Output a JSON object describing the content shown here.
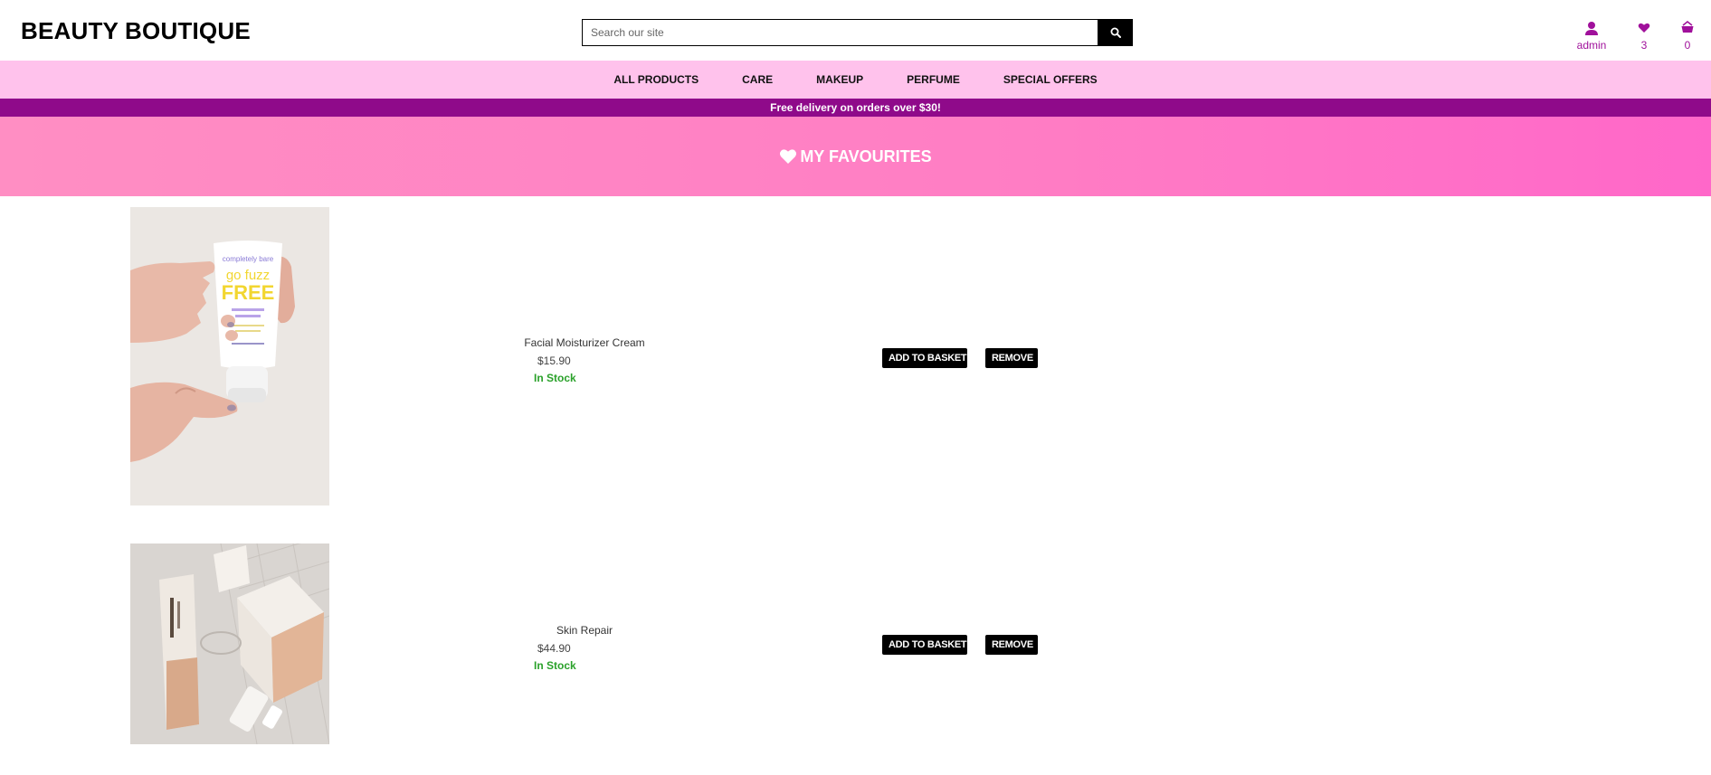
{
  "header": {
    "logo": "BEAUTY BOUTIQUE",
    "search_placeholder": "Search our site",
    "account_label": "admin",
    "favourites_count": "3",
    "basket_count": "0"
  },
  "nav": {
    "items": [
      {
        "label": "ALL PRODUCTS"
      },
      {
        "label": "CARE"
      },
      {
        "label": "MAKEUP"
      },
      {
        "label": "PERFUME"
      },
      {
        "label": "SPECIAL OFFERS"
      }
    ]
  },
  "promo": {
    "text": "Free delivery on orders over $30!"
  },
  "hero": {
    "title": "MY FAVOURITES"
  },
  "favourites": [
    {
      "name": "Facial Moisturizer Cream",
      "price": "$15.90",
      "stock": "In Stock",
      "tube_brand": "completely bare",
      "tube_title_line1": "go fuzz",
      "tube_title_line2": "FREE",
      "add_label": "ADD TO BASKET",
      "remove_label": "REMOVE"
    },
    {
      "name": "Skin Repair",
      "price": "$44.90",
      "stock": "In Stock",
      "add_label": "ADD TO BASKET",
      "remove_label": "REMOVE"
    }
  ],
  "colors": {
    "accent": "#a0109b",
    "nav_bg": "#ffc2ec",
    "promo_bg": "#8f0a8a",
    "hero_bg": "#ff7dc4",
    "in_stock": "#2aa12a"
  }
}
